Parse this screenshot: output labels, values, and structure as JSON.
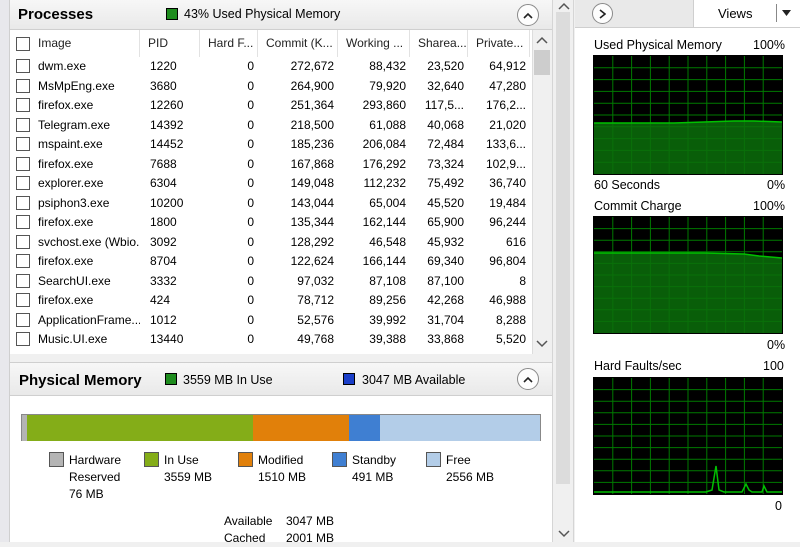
{
  "processes": {
    "title": "Processes",
    "memory_status": "43% Used Physical Memory",
    "columns": [
      "Image",
      "PID",
      "Hard F...",
      "Commit (K...",
      "Working ...",
      "Sharea...",
      "Private..."
    ],
    "rows": [
      [
        "dwm.exe",
        "1220",
        "0",
        "272,672",
        "88,432",
        "23,520",
        "64,912"
      ],
      [
        "MsMpEng.exe",
        "3680",
        "0",
        "264,900",
        "79,920",
        "32,640",
        "47,280"
      ],
      [
        "firefox.exe",
        "12260",
        "0",
        "251,364",
        "293,860",
        "117,5...",
        "176,2..."
      ],
      [
        "Telegram.exe",
        "14392",
        "0",
        "218,500",
        "61,088",
        "40,068",
        "21,020"
      ],
      [
        "mspaint.exe",
        "14452",
        "0",
        "185,236",
        "206,084",
        "72,484",
        "133,6..."
      ],
      [
        "firefox.exe",
        "7688",
        "0",
        "167,868",
        "176,292",
        "73,324",
        "102,9..."
      ],
      [
        "explorer.exe",
        "6304",
        "0",
        "149,048",
        "112,232",
        "75,492",
        "36,740"
      ],
      [
        "psiphon3.exe",
        "10200",
        "0",
        "143,044",
        "65,004",
        "45,520",
        "19,484"
      ],
      [
        "firefox.exe",
        "1800",
        "0",
        "135,344",
        "162,144",
        "65,900",
        "96,244"
      ],
      [
        "svchost.exe (Wbio...",
        "3092",
        "0",
        "128,292",
        "46,548",
        "45,932",
        "616"
      ],
      [
        "firefox.exe",
        "8704",
        "0",
        "122,624",
        "166,144",
        "69,340",
        "96,804"
      ],
      [
        "SearchUI.exe",
        "3332",
        "0",
        "97,032",
        "87,108",
        "87,100",
        "8"
      ],
      [
        "firefox.exe",
        "424",
        "0",
        "78,712",
        "89,256",
        "42,268",
        "46,988"
      ],
      [
        "ApplicationFrame...",
        "1012",
        "0",
        "52,576",
        "39,992",
        "31,704",
        "8,288"
      ],
      [
        "Music.UI.exe",
        "13440",
        "0",
        "49,768",
        "39,388",
        "33,868",
        "5,520"
      ]
    ]
  },
  "physical_memory": {
    "title": "Physical Memory",
    "in_use_label": "3559 MB In Use",
    "available_label": "3047 MB Available",
    "bar_fractions": {
      "hardware_reserved": 0.0093,
      "in_use": 0.4357,
      "modified": 0.1849,
      "standby": 0.0601,
      "free": 0.3129
    },
    "legend": [
      {
        "name": "Hardware\nReserved",
        "value": "76 MB",
        "color": "#b4b4b4"
      },
      {
        "name": "In Use",
        "value": "3559 MB",
        "color": "#84ad18"
      },
      {
        "name": "Modified",
        "value": "1510 MB",
        "color": "#e1800a"
      },
      {
        "name": "Standby",
        "value": "491 MB",
        "color": "#3f7fd2"
      },
      {
        "name": "Free",
        "value": "2556 MB",
        "color": "#b3cde8"
      }
    ],
    "summary": [
      {
        "label": "Available",
        "value": "3047 MB"
      },
      {
        "label": "Cached",
        "value": "2001 MB"
      }
    ]
  },
  "graphs": {
    "views_label": "Views",
    "used_physical_memory": {
      "title": "Used Physical Memory",
      "max": "100%",
      "min": "0%",
      "time": "60 Seconds"
    },
    "commit_charge": {
      "title": "Commit Charge",
      "max": "100%",
      "min": "0%"
    },
    "hard_faults": {
      "title": "Hard Faults/sec",
      "max": "100",
      "min": "0"
    }
  },
  "colors": {
    "graph_line": "#00c000",
    "graph_grid": "#007a00",
    "graph_fill": "#0a6e0a"
  }
}
